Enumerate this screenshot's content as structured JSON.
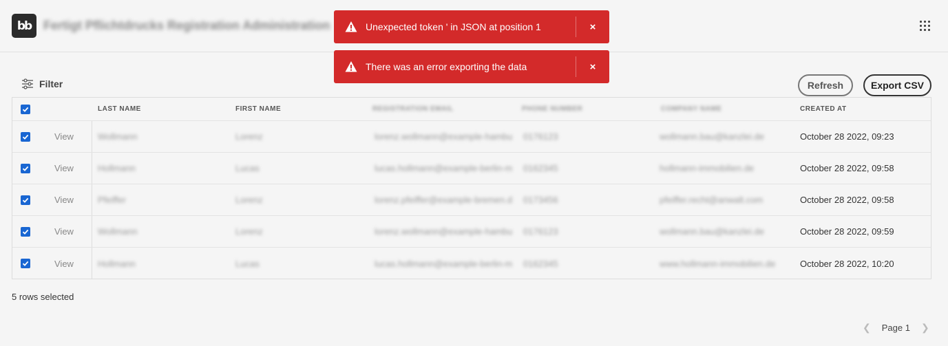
{
  "header": {
    "logo_text": "bb",
    "app_title": "Fertigt Pflichtdrucks Registration Administration",
    "apps_icon": "grid-icon"
  },
  "toasts": [
    {
      "message": "Unexpected token ' in JSON at position 1",
      "close": "×"
    },
    {
      "message": "There was an error exporting the data",
      "close": "×"
    }
  ],
  "toolbar": {
    "filter_label": "Filter",
    "refresh_label": "Refresh",
    "export_label": "Export CSV"
  },
  "table": {
    "columns": [
      "LAST NAME",
      "FIRST NAME",
      "REGISTRATION EMAIL",
      "PHONE NUMBER",
      "COMPANY NAME",
      "CREATED AT"
    ],
    "view_label": "View",
    "rows": [
      {
        "last": "Wollmann",
        "first": "Lorenz",
        "email": "lorenz.wollmann@example-hamburg.de",
        "phone": "0176123",
        "company": "wollmann.bau@kanzlei.de",
        "created": "October 28 2022, 09:23"
      },
      {
        "last": "Hollmann",
        "first": "Lucas",
        "email": "lucas.hollmann@example-berlin-mail.de",
        "phone": "0162345",
        "company": "hollmann-immobilien.de",
        "created": "October 28 2022, 09:58"
      },
      {
        "last": "Pfeiffer",
        "first": "Lorenz",
        "email": "lorenz.pfeiffer@example-bremen.de",
        "phone": "0173456",
        "company": "pfeiffer.recht@anwalt.com",
        "created": "October 28 2022, 09:58"
      },
      {
        "last": "Wollmann",
        "first": "Lorenz",
        "email": "lorenz.wollmann@example-hamburg.de",
        "phone": "0176123",
        "company": "wollmann.bau@kanzlei.de",
        "created": "October 28 2022, 09:59"
      },
      {
        "last": "Hollmann",
        "first": "Lucas",
        "email": "lucas.hollmann@example-berlin-mail.de",
        "phone": "0162345",
        "company": "www.hollmann-immobilien.de",
        "created": "October 28 2022, 10:20"
      }
    ]
  },
  "footer": {
    "selected_text": "5 rows selected",
    "page_label": "Page 1"
  },
  "colors": {
    "toast_bg": "#d32a2a",
    "checkbox": "#1966d2",
    "text": "#2b2b2b"
  }
}
